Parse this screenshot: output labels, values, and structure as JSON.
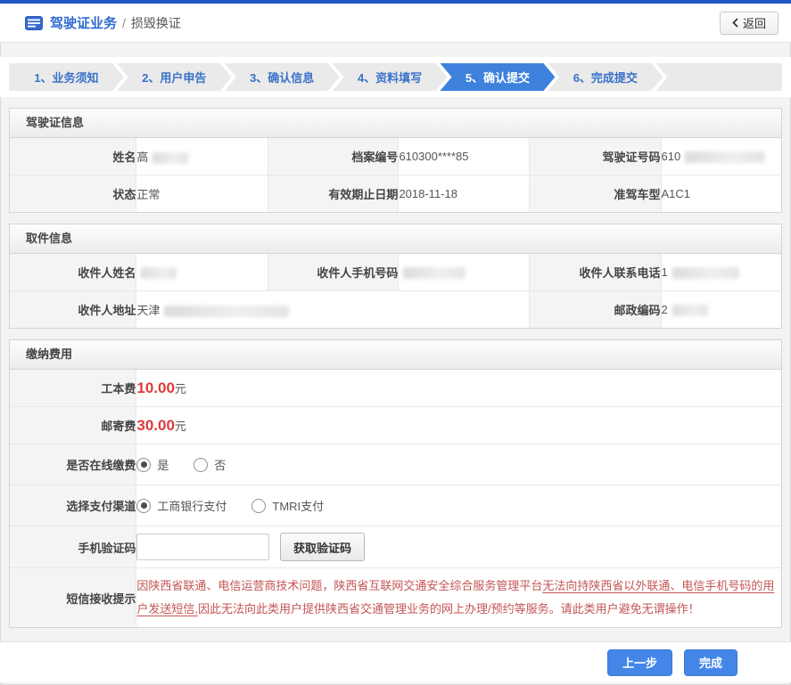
{
  "header": {
    "title": "驾驶证业务",
    "separator": "/",
    "subtitle": "损毁换证",
    "back_button": "返回"
  },
  "steps": [
    {
      "label": "1、业务须知"
    },
    {
      "label": "2、用户申告"
    },
    {
      "label": "3、确认信息"
    },
    {
      "label": "4、资料填写"
    },
    {
      "label": "5、确认提交"
    },
    {
      "label": "6、完成提交"
    }
  ],
  "active_step": "5、确认提交",
  "license": {
    "title": "驾驶证信息",
    "name_label": "姓名",
    "name_value": "高",
    "file_no_label": "档案编号",
    "file_no_value": "610300****85",
    "license_no_label": "驾驶证号码",
    "license_no_value": "610",
    "status_label": "状态",
    "status_value": "正常",
    "expiry_label": "有效期止日期",
    "expiry_value": "2018-11-18",
    "vehicle_class_label": "准驾车型",
    "vehicle_class_value": "A1C1"
  },
  "pickup": {
    "title": "取件信息",
    "recipient_name_label": "收件人姓名",
    "recipient_name_value": "",
    "recipient_mobile_label": "收件人手机号码",
    "recipient_mobile_value": "",
    "recipient_phone_label": "收件人联系电话",
    "recipient_phone_value": "1",
    "recipient_address_label": "收件人地址",
    "recipient_address_value": "天津",
    "postcode_label": "邮政编码",
    "postcode_value": "2"
  },
  "fees": {
    "title": "缴纳费用",
    "work_fee_label": "工本费",
    "work_fee_amount": "10.00",
    "work_fee_unit": "元",
    "postage_label": "邮寄费",
    "postage_amount": "30.00",
    "postage_unit": "元",
    "online_pay_label": "是否在线缴费",
    "online_options": [
      {
        "label": "是",
        "selected": true
      },
      {
        "label": "否",
        "selected": false
      }
    ],
    "channel_label": "选择支付渠道",
    "channel_options": [
      {
        "label": "工商银行支付",
        "selected": true
      },
      {
        "label": "TMRI支付",
        "selected": false
      }
    ],
    "sms_code_label": "手机验证码",
    "sms_code_value": "",
    "get_code_button": "获取验证码",
    "notice_label": "短信接收提示",
    "notice_part1": "因陕西省联通、电信运营商技术问题，陕西省互联网交通安全综合服务管理平台",
    "notice_part2_underlined": "无法向持陕西省以外联通、电信手机号码的用户发送短信,",
    "notice_part3": "因此无法向此类用户提供陕西省交通管理业务的网上办理/预约等服务。请此类用户避免无谓操作！"
  },
  "footer": {
    "prev_button": "上一步",
    "finish_button": "完成"
  },
  "colors": {
    "top_bar": "#1e55c5",
    "accent_blue": "#3e82de",
    "button_blue": "#4486e8",
    "price_red": "#e03a3a",
    "notice_red": "#c45454"
  }
}
